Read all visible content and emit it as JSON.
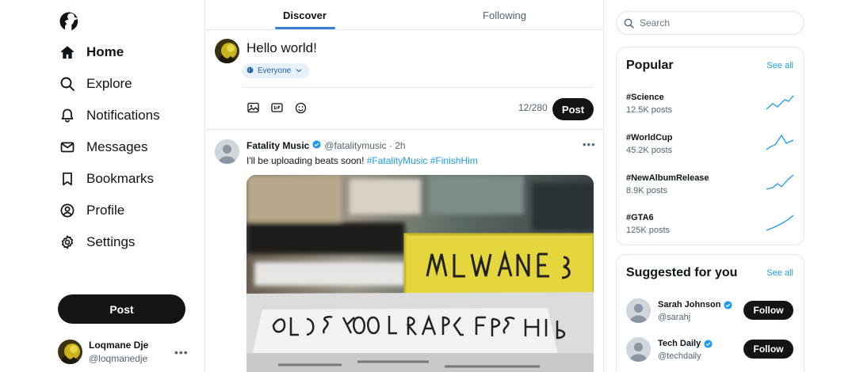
{
  "sidebar": {
    "items": [
      {
        "label": "Home",
        "icon": "home-icon",
        "active": true
      },
      {
        "label": "Explore",
        "icon": "search-icon"
      },
      {
        "label": "Notifications",
        "icon": "bell-icon"
      },
      {
        "label": "Messages",
        "icon": "envelope-icon"
      },
      {
        "label": "Bookmarks",
        "icon": "bookmark-icon"
      },
      {
        "label": "Profile",
        "icon": "user-circle-icon"
      },
      {
        "label": "Settings",
        "icon": "gear-icon"
      }
    ],
    "post_label": "Post",
    "user": {
      "name": "Loqmane Dje",
      "handle": "@loqmanedje"
    }
  },
  "tabs": {
    "discover": "Discover",
    "following": "Following"
  },
  "compose": {
    "text": "Hello world!",
    "audience": "Everyone",
    "count": "12/280",
    "post_label": "Post"
  },
  "tweet": {
    "name": "Fatality Music",
    "handle": "@fatalitymusic",
    "time": "· 2h",
    "text": "I'll be uploading beats soon! ",
    "tags": [
      "#FatalityMusic",
      "#FinishHim"
    ]
  },
  "search": {
    "placeholder": "Search"
  },
  "popular": {
    "title": "Popular",
    "see_all": "See all",
    "items": [
      {
        "tag": "#Science",
        "posts": "12.5K posts"
      },
      {
        "tag": "#WorldCup",
        "posts": "45.2K posts"
      },
      {
        "tag": "#NewAlbumRelease",
        "posts": "8.9K posts"
      },
      {
        "tag": "#GTA6",
        "posts": "125K posts"
      }
    ]
  },
  "suggested": {
    "title": "Suggested for you",
    "see_all": "See all",
    "follow_label": "Follow",
    "items": [
      {
        "name": "Sarah Johnson",
        "handle": "@sarahj"
      },
      {
        "name": "Tech Daily",
        "handle": "@techdaily"
      }
    ]
  },
  "colors": {
    "accent": "#1d9bf0",
    "tab_indicator": "#3a7bd5",
    "button": "#141414"
  }
}
